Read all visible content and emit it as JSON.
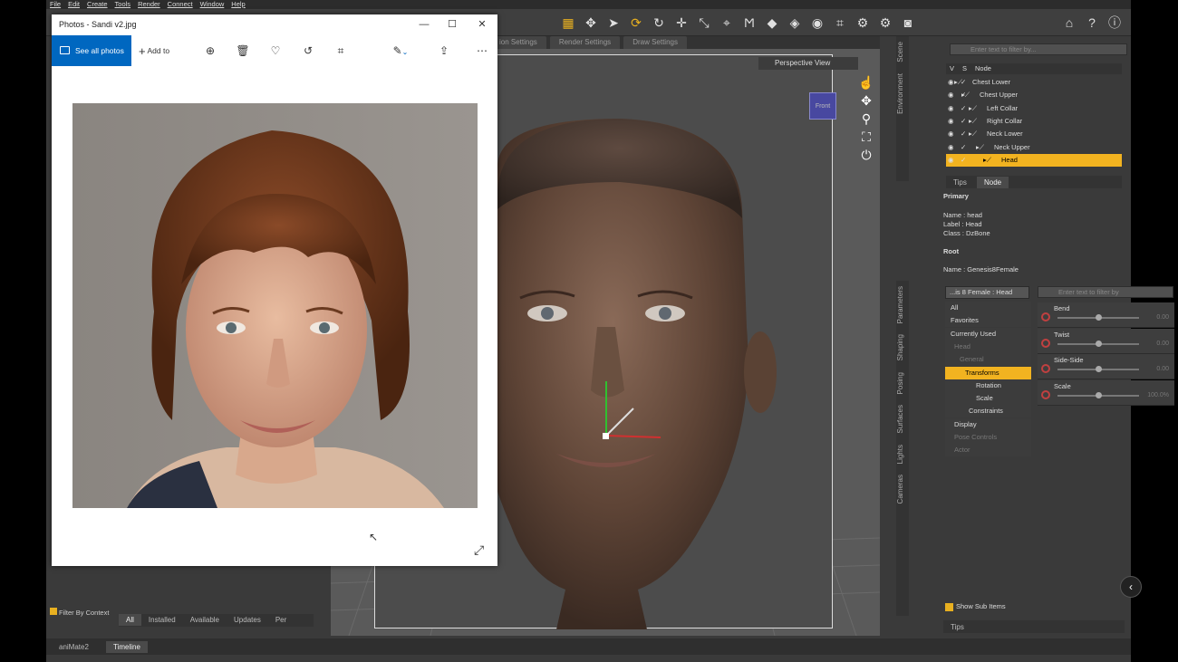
{
  "menu": [
    "File",
    "Edit",
    "Create",
    "Tools",
    "Render",
    "Connect",
    "Window",
    "Help"
  ],
  "viewport_tabs": [
    "ion Settings",
    "Render Settings",
    "Draw Settings"
  ],
  "viewport": {
    "view_label": "Perspective View",
    "cube_label": "Front"
  },
  "scene": {
    "filter_placeholder": "Enter text to filter by...",
    "col_v": "V",
    "col_s": "S",
    "col_node": "Node",
    "side_tabs": [
      "Scene",
      "Environment"
    ],
    "tree": [
      "Chest Lower",
      "Chest Upper",
      "Left Collar",
      "Right Collar",
      "Neck Lower",
      "Neck Upper",
      "Head"
    ],
    "tree_selected": "Head"
  },
  "node_info": {
    "tabs": [
      "Tips",
      "Node"
    ],
    "primary_heading": "Primary",
    "name": "Name : head",
    "label": "Label : Head",
    "class": "Class : DzBone",
    "root_heading": "Root",
    "root_name": "Name : Genesis8Female"
  },
  "parameters": {
    "side_tabs": [
      "Parameters",
      "Shaping",
      "Posing",
      "Surfaces",
      "Lights",
      "Cameras"
    ],
    "selector": "...is 8 Female : Head",
    "filter_placeholder": "Enter text to filter by",
    "categories": [
      "All",
      "Favorites",
      "Currently Used",
      "Head",
      "General",
      "Transforms",
      "Rotation",
      "Scale",
      "Constraints",
      "Display",
      "Pose Controls",
      "Actor"
    ],
    "selected_category": "Transforms",
    "sliders": [
      {
        "label": "Bend",
        "value": "0.00",
        "level": 0.5
      },
      {
        "label": "Twist",
        "value": "0.00",
        "level": 0.5
      },
      {
        "label": "Side-Side",
        "value": "0.00",
        "level": 0.5
      },
      {
        "label": "Scale",
        "value": "100.0%",
        "level": 0.5
      }
    ],
    "show_sub_items": "Show Sub Items",
    "bottom_tab": "Tips"
  },
  "left_pane": {
    "filter_by_context": "Filter By Context",
    "tabs": [
      "All",
      "Installed",
      "Available",
      "Updates",
      "Per"
    ]
  },
  "bottom_tabs": [
    "aniMate2",
    "Timeline"
  ],
  "photos": {
    "title": "Photos - Sandi v2.jpg",
    "see_all": "See all photos",
    "add_to": "Add to"
  }
}
